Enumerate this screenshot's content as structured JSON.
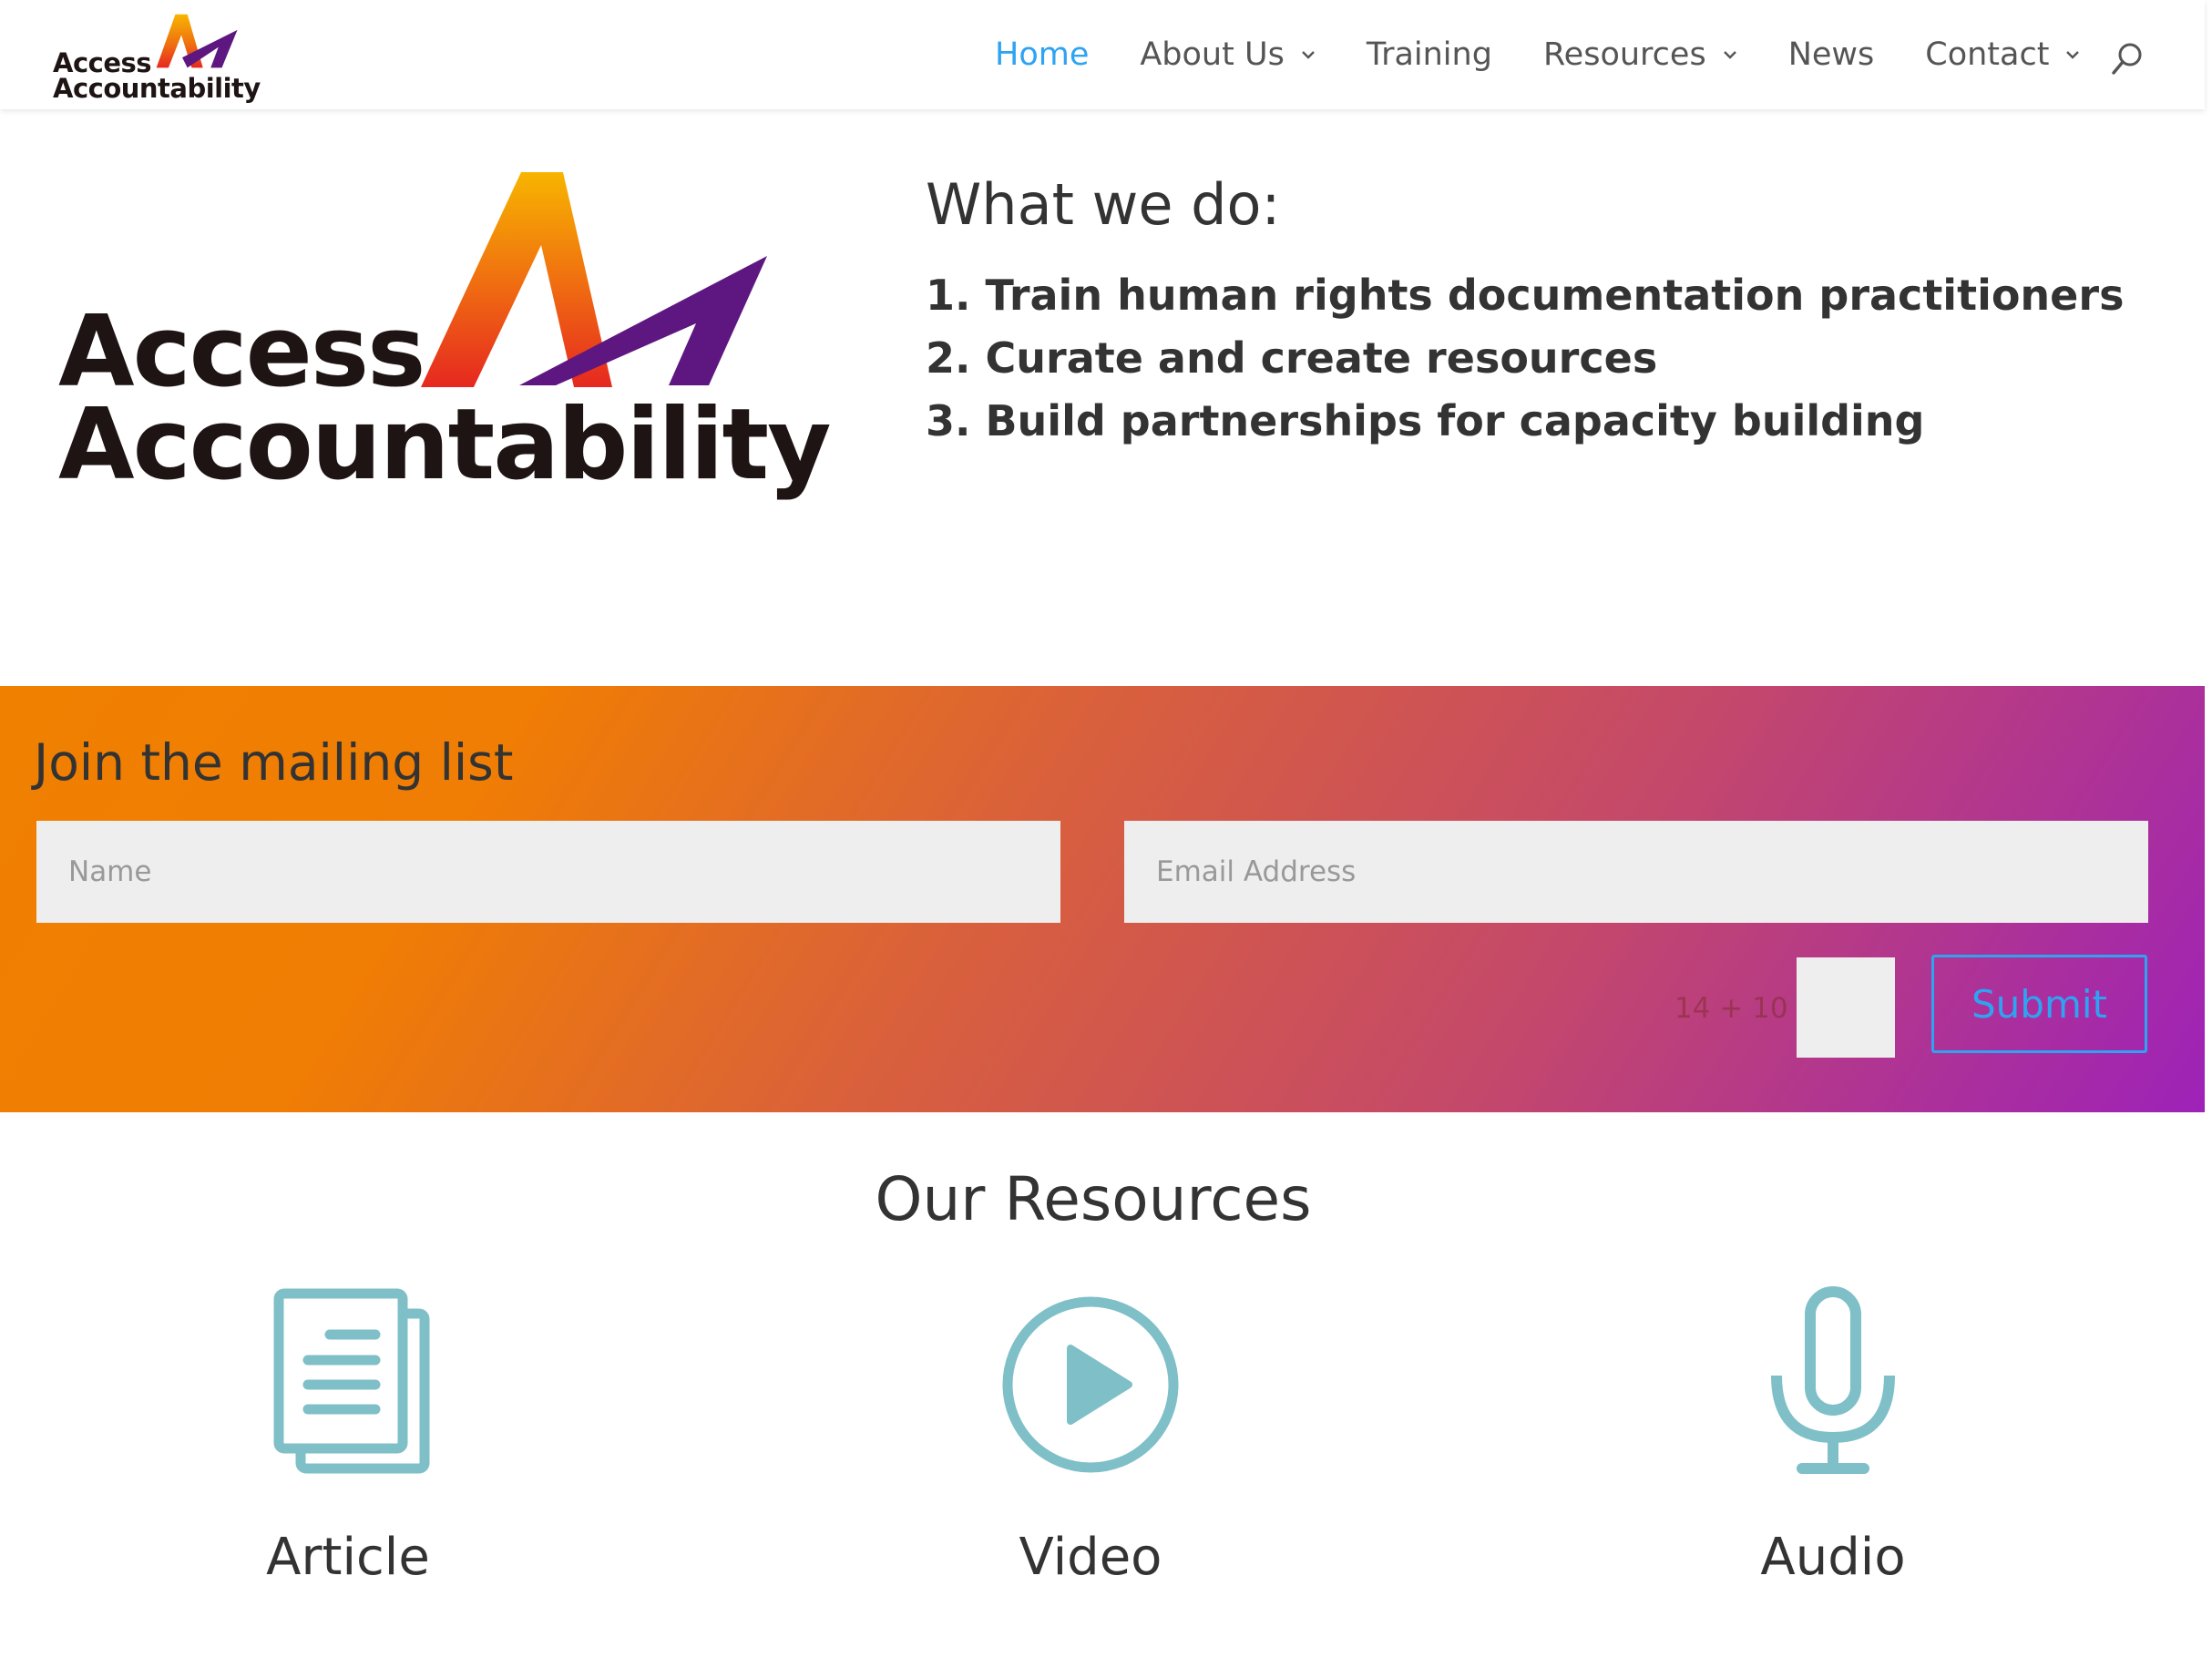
{
  "header": {
    "logo": {
      "line1": "Access",
      "line2": "Accountability"
    },
    "nav": [
      {
        "label": "Home",
        "active": true,
        "has_dropdown": false
      },
      {
        "label": "About Us",
        "active": false,
        "has_dropdown": true
      },
      {
        "label": "Training",
        "active": false,
        "has_dropdown": false
      },
      {
        "label": "Resources",
        "active": false,
        "has_dropdown": true
      },
      {
        "label": "News",
        "active": false,
        "has_dropdown": false
      },
      {
        "label": "Contact",
        "active": false,
        "has_dropdown": true
      }
    ],
    "search_icon": "search-icon"
  },
  "hero": {
    "logo": {
      "line1": "Access",
      "line2": "Accountability"
    },
    "heading": "What we do:",
    "items": [
      "1. Train human rights documentation practitioners",
      "2. Curate and create resources",
      "3. Build partnerships for capacity building"
    ]
  },
  "mailing": {
    "title": "Join the mailing list",
    "name_placeholder": "Name",
    "email_placeholder": "Email Address",
    "captcha_question": "14 + 10 =",
    "submit_label": "Submit"
  },
  "resources": {
    "title": "Our Resources",
    "items": [
      {
        "label": "Article",
        "icon": "document-icon"
      },
      {
        "label": "Video",
        "icon": "play-circle-icon"
      },
      {
        "label": "Audio",
        "icon": "microphone-icon"
      }
    ]
  },
  "colors": {
    "accent_blue": "#2ea3f2",
    "icon_teal": "#7fbfc7",
    "band_orange": "#f08000",
    "band_purple": "#9d22b8"
  }
}
